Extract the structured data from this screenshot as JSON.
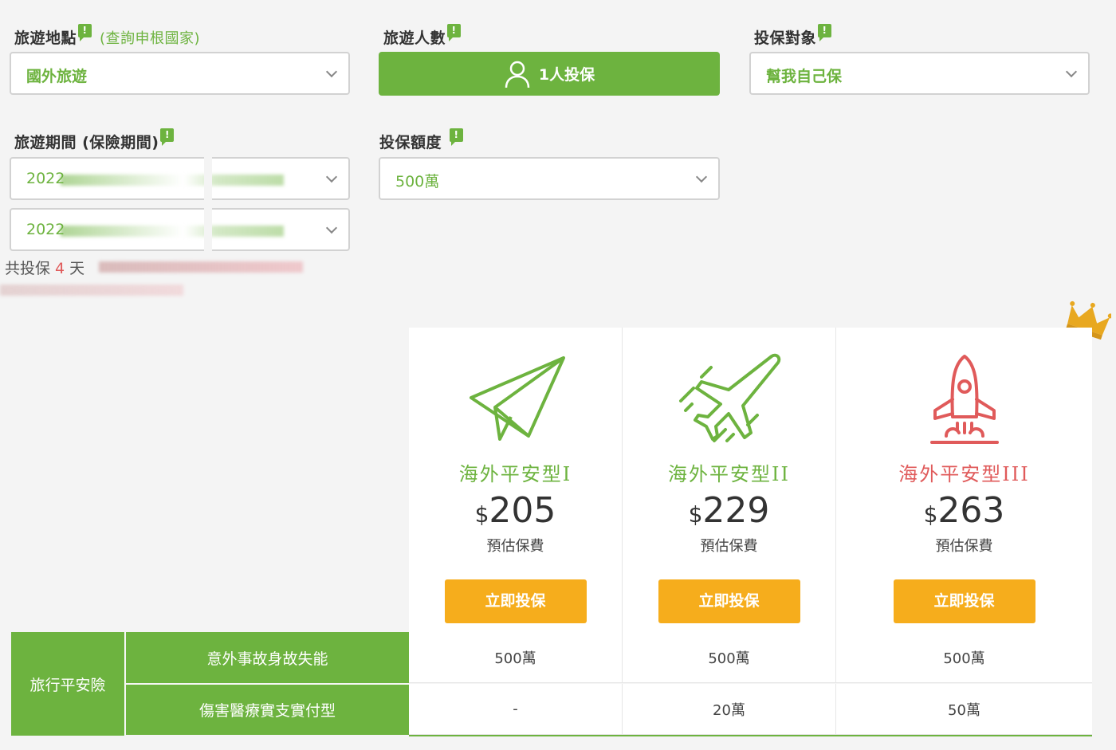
{
  "form": {
    "destination": {
      "label": "旅遊地點",
      "hint": "(查詢申根國家)",
      "value": "國外旅遊"
    },
    "travelers": {
      "label": "旅遊人數",
      "button": "1人投保"
    },
    "insured": {
      "label": "投保對象",
      "value": "幫我自己保"
    },
    "period": {
      "label": "旅遊期間 (保險期間)",
      "start_year": "2022",
      "end_year": "2022"
    },
    "amount": {
      "label": "投保額度",
      "value": "500萬"
    },
    "days": {
      "prefix": "共投保",
      "count": "4",
      "suffix": "天"
    },
    "info_glyph": "!"
  },
  "plans": [
    {
      "name": "海外平安型I",
      "currency": "$",
      "price": "205",
      "est_label": "預估保費",
      "cta": "立即投保",
      "icon": "paper-plane-icon",
      "color": "#6db33f"
    },
    {
      "name": "海外平安型II",
      "currency": "$",
      "price": "229",
      "est_label": "預估保費",
      "cta": "立即投保",
      "icon": "airplane-icon",
      "color": "#6db33f"
    },
    {
      "name": "海外平安型III",
      "currency": "$",
      "price": "263",
      "est_label": "預估保費",
      "cta": "立即投保",
      "icon": "rocket-icon",
      "color": "#e05a5a"
    }
  ],
  "table": {
    "category": "旅行平安險",
    "rows": [
      {
        "label": "意外事故身故失能",
        "values": [
          "500萬",
          "500萬",
          "500萬"
        ]
      },
      {
        "label": "傷害醫療實支實付型",
        "values": [
          "-",
          "20萬",
          "50萬"
        ]
      }
    ]
  },
  "colors": {
    "green": "#6db33f",
    "orange": "#f6ad1c",
    "red": "#e05a5a",
    "gold": "#e8a820"
  }
}
